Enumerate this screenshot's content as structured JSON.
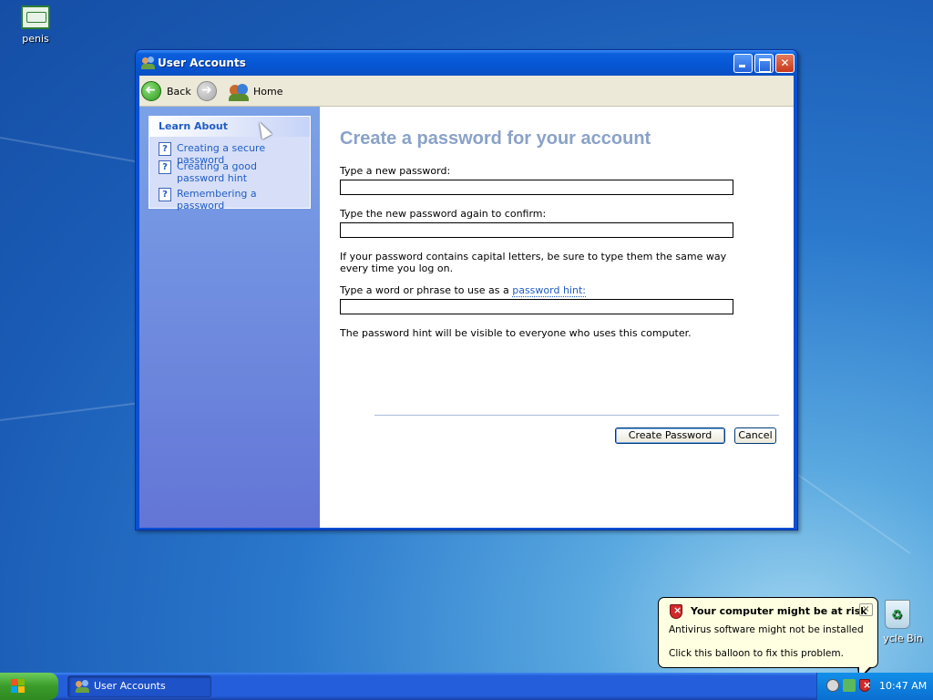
{
  "desktop": {
    "icons": [
      {
        "label": "penis",
        "icon": "certificate-icon"
      }
    ],
    "recycle_bin_label": "ycle Bin"
  },
  "window": {
    "title": "User Accounts",
    "toolbar": {
      "back_label": "Back",
      "home_label": "Home"
    },
    "sidebar": {
      "heading": "Learn About",
      "items": [
        {
          "label": "Creating a secure password"
        },
        {
          "label": "Creating a good password hint"
        },
        {
          "label": "Remembering a password"
        }
      ]
    },
    "main": {
      "heading": "Create a password for your account",
      "new_password_label": "Type a new password:",
      "confirm_label": "Type the new password again to confirm:",
      "caps_note": "If your password contains capital letters, be sure to type them the same way every time you log on.",
      "hint_label_prefix": "Type a word or phrase to use as a ",
      "hint_link": "password hint:",
      "hint_visibility_note": "The password hint will be visible to everyone who uses this computer.",
      "fields": {
        "new_password": "",
        "confirm_password": "",
        "hint": ""
      },
      "create_button": "Create Password",
      "cancel_button": "Cancel"
    }
  },
  "balloon": {
    "title": "Your computer might be at risk",
    "line1": "Antivirus software might not be installed",
    "line2": "Click this balloon to fix this problem.",
    "close_glyph": "×"
  },
  "taskbar": {
    "task_label": "User Accounts",
    "clock": "10:47 AM"
  },
  "colors": {
    "heading": "#8aa2c8",
    "link": "#215dc6",
    "balloon_bg": "#ffffe1",
    "titlebar": "#0656d4"
  }
}
